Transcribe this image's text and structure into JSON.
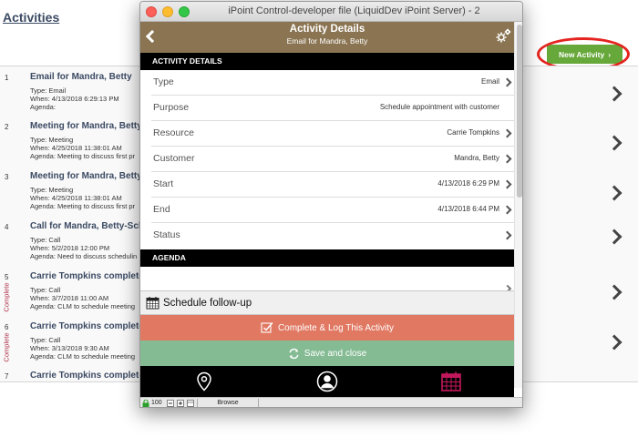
{
  "page": {
    "title": "Activities"
  },
  "new_activity": {
    "label": "New Activity"
  },
  "activities": [
    {
      "num": "1",
      "name": "Email for Mandra, Betty",
      "lines": [
        "Type: Email",
        "When: 4/13/2018 6:29:13 PM",
        "Agenda:"
      ],
      "complete": ""
    },
    {
      "num": "2",
      "name": "Meeting for Mandra, Betty",
      "lines": [
        "Type: Meeting",
        "When: 4/25/2018 11:38:01 AM",
        "Agenda: Meeting to discuss first pr"
      ],
      "complete": ""
    },
    {
      "num": "3",
      "name": "Meeting for Mandra, Betty",
      "lines": [
        "Type: Meeting",
        "When: 4/25/2018 11:38:01 AM",
        "Agenda: Meeting to discuss first pr"
      ],
      "complete": ""
    },
    {
      "num": "4",
      "name": "Call for Mandra, Betty-Sche",
      "lines": [
        "Type: Call",
        "When: 5/2/2018 12:00 PM",
        "Agenda: Need to discuss schedulin"
      ],
      "complete": ""
    },
    {
      "num": "5",
      "name": "Carrie Tompkins completed",
      "lines": [
        "Type: Call",
        "When: 3/7/2018 11:00 AM",
        "Agenda: CLM to schedule meeting"
      ],
      "complete": "Complete"
    },
    {
      "num": "6",
      "name": "Carrie Tompkins completed",
      "lines": [
        "Type: Call",
        "When: 3/13/2018 9:30 AM",
        "Agenda: CLM to schedule meeting"
      ],
      "complete": "Complete"
    },
    {
      "num": "7",
      "name": "Carrie Tompkins completed",
      "lines": [],
      "complete": ""
    }
  ],
  "window": {
    "title": "iPoint Control-developer file (LiquidDev iPoint Server) - 2"
  },
  "header": {
    "title": "Activity Details",
    "subtitle": "Email for Mandra, Betty"
  },
  "details": {
    "section_label": "ACTIVITY DETAILS",
    "rows": [
      {
        "label": "Type",
        "value": "Email"
      },
      {
        "label": "Purpose",
        "value": "Schedule  appointment with customer"
      },
      {
        "label": "Resource",
        "value": "Carrie Tompkins"
      },
      {
        "label": "Customer",
        "value": "Mandra, Betty"
      },
      {
        "label": "Start",
        "value": "4/13/2018 6:29 PM"
      },
      {
        "label": "End",
        "value": "4/13/2018 6:44 PM"
      },
      {
        "label": "Status",
        "value": ""
      }
    ]
  },
  "agenda": {
    "section_label": "AGENDA"
  },
  "actions": {
    "followup_label": "Schedule follow-up",
    "complete_label": "Complete & Log This Activity",
    "save_label": "Save and close"
  },
  "statusbar": {
    "zoom": "100",
    "mode": "Browse"
  },
  "colors": {
    "header_brown": "#8a7452",
    "complete_red": "#e07862",
    "save_green": "#84bb93",
    "new_activity_green": "#67a83a",
    "highlight_red": "#e52420",
    "calendar_icon": "#c2185b"
  },
  "icons": {
    "back": "chevron-left-icon",
    "settings": "gear-icon",
    "followup": "calendar-icon",
    "complete": "checkbox-icon",
    "save": "refresh-icon",
    "tabs": [
      "location-pin-icon",
      "person-icon",
      "calendar-icon"
    ]
  }
}
